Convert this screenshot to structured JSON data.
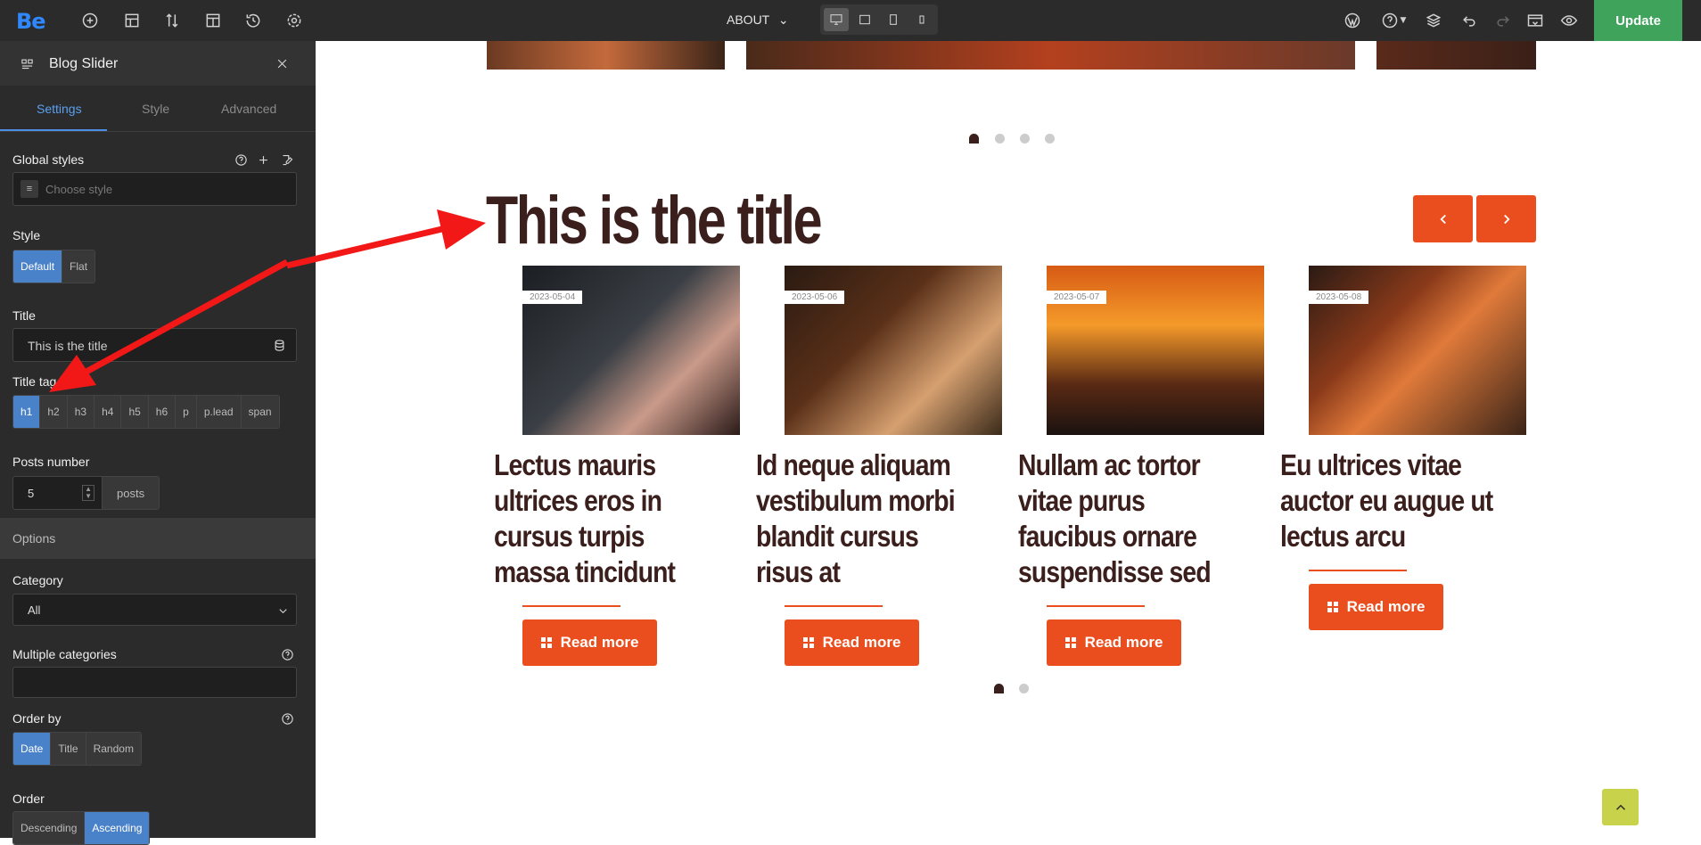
{
  "topbar": {
    "logo": "Be",
    "page_select": "ABOUT",
    "update_label": "Update",
    "icons": [
      "add-icon",
      "layout-icon",
      "sort-icon",
      "template-icon",
      "history-icon",
      "settings-icon",
      "wordpress-icon",
      "help-icon",
      "layers-icon",
      "undo-icon",
      "redo-icon",
      "preview-icon",
      "eye-icon"
    ],
    "devices": [
      "desktop-icon",
      "tablet-icon",
      "tablet-portrait-icon",
      "mobile-icon"
    ]
  },
  "sidebar": {
    "title": "Blog Slider",
    "tabs": [
      "Settings",
      "Style",
      "Advanced"
    ],
    "global_styles_label": "Global styles",
    "global_styles_placeholder": "Choose style",
    "style_label": "Style",
    "style_options": [
      "Default",
      "Flat"
    ],
    "title_label": "Title",
    "title_value": "This is the title",
    "title_tag_label": "Title tag",
    "title_tag_options": [
      "h1",
      "h2",
      "h3",
      "h4",
      "h5",
      "h6",
      "p",
      "p.lead",
      "span"
    ],
    "posts_number_label": "Posts number",
    "posts_number_value": "5",
    "posts_suffix": "posts",
    "options_label": "Options",
    "category_label": "Category",
    "category_value": "All",
    "multiple_categories_label": "Multiple categories",
    "order_by_label": "Order by",
    "order_by_options": [
      "Date",
      "Title",
      "Random"
    ],
    "order_label": "Order",
    "order_options": [
      "Descending",
      "Ascending"
    ]
  },
  "canvas": {
    "title": "This is the title",
    "cards": [
      {
        "date": "2023-05-04",
        "title": "Lectus mauris ultrices eros in cursus turpis massa tincidunt",
        "button": "Read more"
      },
      {
        "date": "2023-05-06",
        "title": "Id neque aliquam vestibulum morbi blandit cursus risus at",
        "button": "Read more"
      },
      {
        "date": "2023-05-07",
        "title": "Nullam ac tortor vitae purus faucibus ornare suspendisse sed",
        "button": "Read more"
      },
      {
        "date": "2023-05-08",
        "title": "Eu ultrices vitae auctor eu augue ut lectus arcu",
        "button": "Read more"
      }
    ]
  },
  "colors": {
    "accent": "#ea4e1e",
    "title_color": "#3a1f1c",
    "update_green": "#3fa35b",
    "active_blue": "#4a82c9"
  }
}
